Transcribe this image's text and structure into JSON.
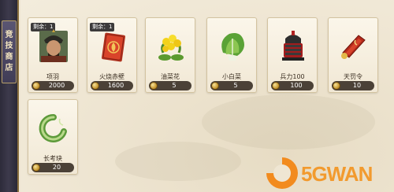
{
  "sidebar": {
    "tab_chars": [
      "竞",
      "技",
      "商",
      "店"
    ]
  },
  "stock_label": "剩余：1",
  "items": [
    {
      "name": "项羽",
      "price": "2000",
      "stock": true,
      "art": "portrait-icon"
    },
    {
      "name": "火烧赤壁",
      "price": "1600",
      "stock": true,
      "art": "card-icon"
    },
    {
      "name": "油菜花",
      "price": "5",
      "stock": false,
      "art": "flower-icon"
    },
    {
      "name": "小白菜",
      "price": "5",
      "stock": false,
      "art": "cabbage-icon"
    },
    {
      "name": "兵力100",
      "price": "100",
      "stock": false,
      "art": "armor-icon"
    },
    {
      "name": "天罚令",
      "price": "10",
      "stock": false,
      "art": "token-icon"
    },
    {
      "name": "长考玦",
      "price": "20",
      "stock": false,
      "art": "jade-ring-icon"
    }
  ],
  "watermark": {
    "text": "5GWAN",
    "color": "#f29a2e"
  }
}
